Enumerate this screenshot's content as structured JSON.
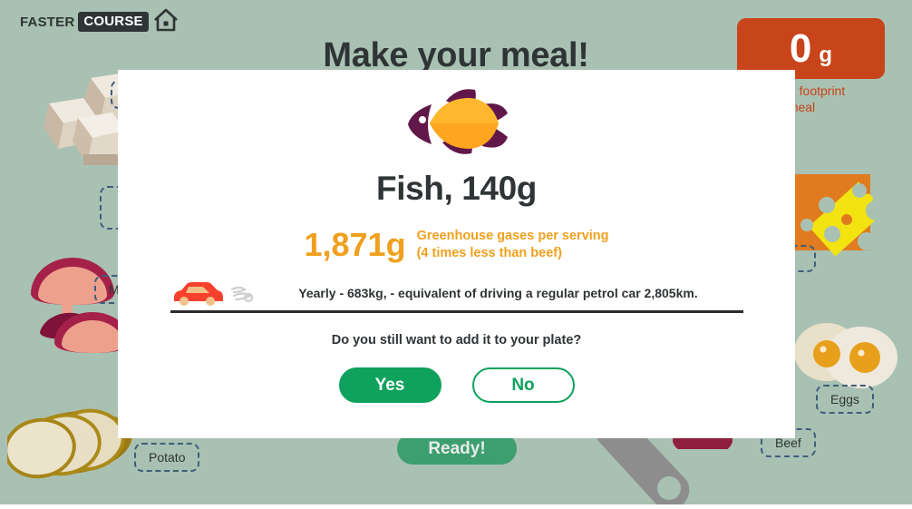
{
  "brand": {
    "logo_first": "FASTER",
    "logo_second": "COURSE",
    "home_icon": "home-icon"
  },
  "page": {
    "title": "Make your meal!",
    "background_color": "#a9c1b2",
    "ready_button": "Ready!"
  },
  "co2_counter": {
    "value": "0",
    "unit": "g",
    "caption": "et CO₂ footprint\n meal",
    "caption_line1": "et CO₂ footprint",
    "caption_line2": " meal",
    "box_color": "#c8441a",
    "text_color": "#ffffff"
  },
  "ingredients": [
    {
      "name": "Tofu",
      "label": "Tofu"
    },
    {
      "name": "Mushrooms",
      "label": "Mu"
    },
    {
      "name": "Potato",
      "label": "Potato"
    },
    {
      "name": "Cheese",
      "label": ""
    },
    {
      "name": "Eggs",
      "label": "Eggs"
    },
    {
      "name": "Beef",
      "label": "Beef"
    }
  ],
  "modal": {
    "icon": "fish-icon",
    "title": "Fish, 140g",
    "ghg_value": "1,871g",
    "ghg_desc_line1": "Greenhouse gases per serving",
    "ghg_desc_line2": "(4 times less than beef)",
    "ghg_color": "#f0a01e",
    "car_icon": "car-icon",
    "smoke_icon": "exhaust-smoke-icon",
    "car_text": "Yearly - 683kg, - equivalent of driving a regular petrol car 2,805km.",
    "confirm_question": "Do you still want to add it to your plate?",
    "yes_label": "Yes",
    "no_label": "No",
    "accent_color": "#0ea25c"
  }
}
